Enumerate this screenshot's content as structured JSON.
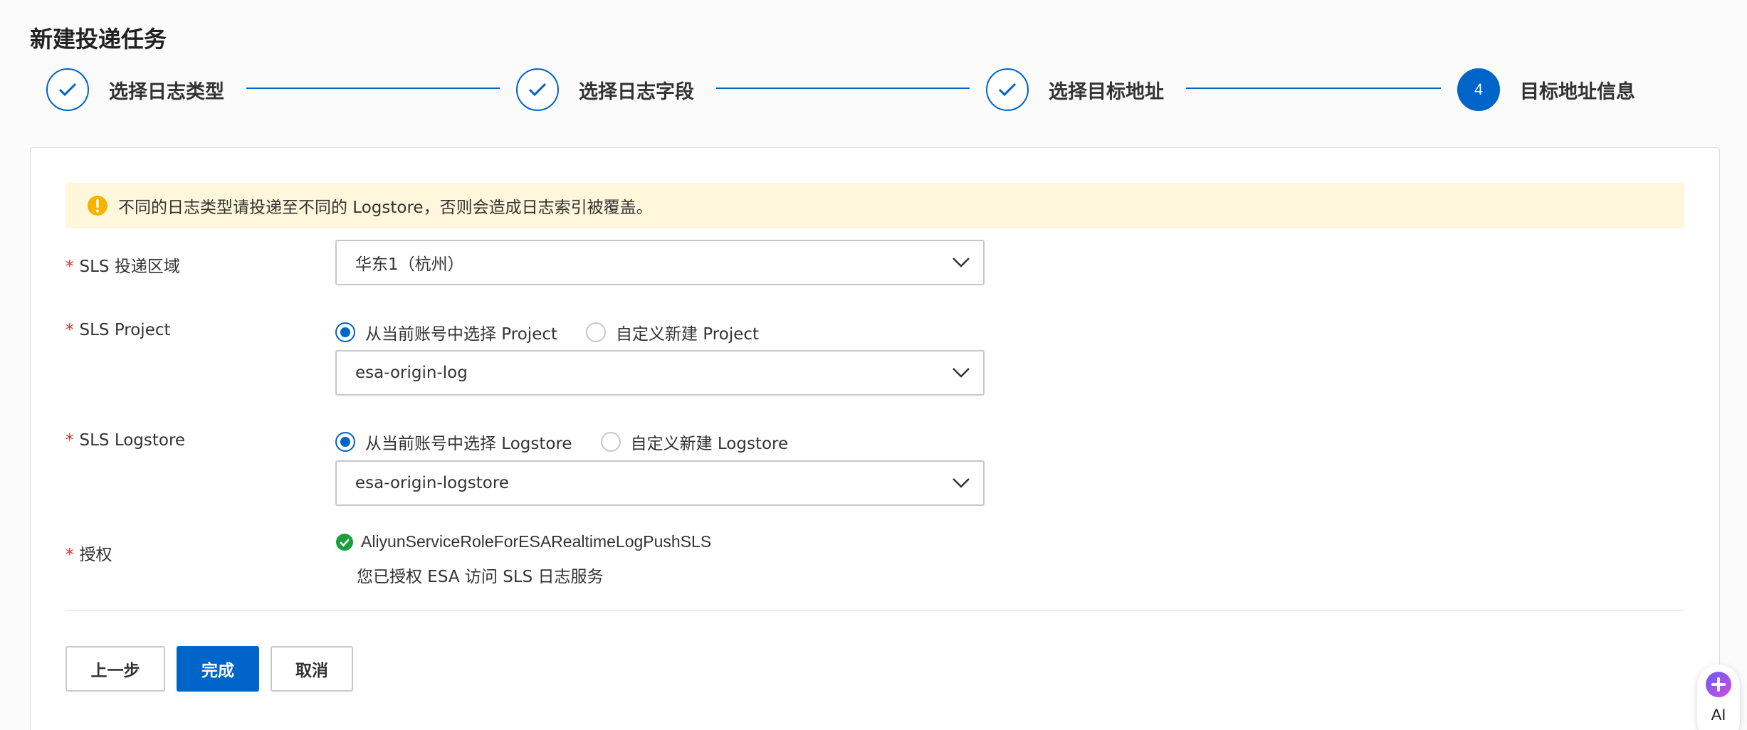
{
  "page": {
    "title": "新建投递任务"
  },
  "steps": [
    {
      "label": "选择日志类型",
      "status": "done"
    },
    {
      "label": "选择日志字段",
      "status": "done"
    },
    {
      "label": "选择目标地址",
      "status": "done"
    },
    {
      "label": "目标地址信息",
      "status": "active",
      "number": "4"
    }
  ],
  "alert": {
    "icon": "warning-icon",
    "text": "不同的日志类型请投递至不同的 Logstore，否则会造成日志索引被覆盖。"
  },
  "form": {
    "required_mark": "*",
    "region": {
      "label": "SLS 投递区域",
      "value": "华东1（杭州）"
    },
    "project": {
      "label": "SLS Project",
      "radio_existing": "从当前账号中选择 Project",
      "radio_new": "自定义新建 Project",
      "selected": "existing",
      "value": "esa-origin-log"
    },
    "logstore": {
      "label": "SLS Logstore",
      "radio_existing": "从当前账号中选择 Logstore",
      "radio_new": "自定义新建 Logstore",
      "selected": "existing",
      "value": "esa-origin-logstore"
    },
    "auth": {
      "label": "授权",
      "role": "AliyunServiceRoleForESARealtimeLogPushSLS",
      "description": "您已授权 ESA 访问 SLS 日志服务",
      "status_icon": "check-circle-icon"
    }
  },
  "buttons": {
    "prev": "上一步",
    "finish": "完成",
    "cancel": "取消"
  },
  "ai_widget": {
    "label": "AI"
  },
  "colors": {
    "primary": "#0064c8",
    "warning": "#f5b400",
    "success": "#1a9f3c",
    "required": "#d93026",
    "alert_bg": "#fff7db"
  }
}
